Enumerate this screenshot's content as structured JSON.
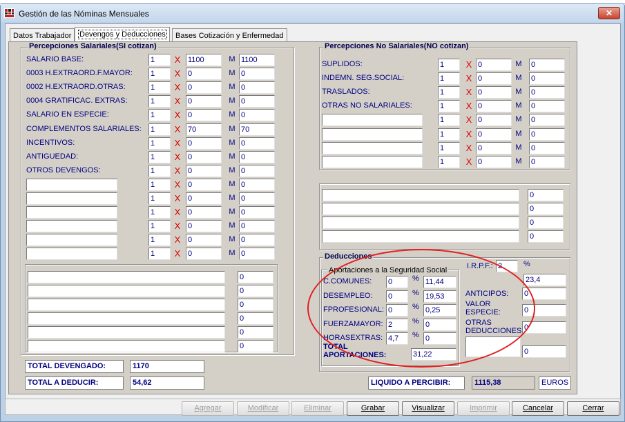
{
  "window": {
    "title": "Gestión de las Nóminas Mensuales",
    "close_label": "✕"
  },
  "tabs": [
    "Datos Trabajador",
    "Devengos y Deducciones",
    "Bases Cotización y Enfermedad"
  ],
  "salariales": {
    "title": "Percepciones Salariales(SI cotizan)",
    "rows": [
      {
        "label": "SALARIO BASE:",
        "qty": "1",
        "price": "1100",
        "total": "1100"
      },
      {
        "label": "0003 H.EXTRAORD.F.MAYOR:",
        "qty": "1",
        "price": "0",
        "total": "0"
      },
      {
        "label": "0002 H.EXTRAORD.OTRAS:",
        "qty": "1",
        "price": "0",
        "total": "0"
      },
      {
        "label": "0004 GRATIFICAC. EXTRAS:",
        "qty": "1",
        "price": "0",
        "total": "0"
      },
      {
        "label": "SALARIO EN ESPECIE:",
        "qty": "1",
        "price": "0",
        "total": "0"
      },
      {
        "label": "COMPLEMENTOS SALARIALES:",
        "qty": "1",
        "price": "70",
        "total": "70"
      },
      {
        "label": "INCENTIVOS:",
        "qty": "1",
        "price": "0",
        "total": "0"
      },
      {
        "label": "ANTIGUEDAD:",
        "qty": "1",
        "price": "0",
        "total": "0"
      },
      {
        "label": "OTROS DEVENGOS:",
        "qty": "1",
        "price": "0",
        "total": "0"
      },
      {
        "label": "",
        "qty": "1",
        "price": "0",
        "total": "0"
      },
      {
        "label": "",
        "qty": "1",
        "price": "0",
        "total": "0"
      },
      {
        "label": "",
        "qty": "1",
        "price": "0",
        "total": "0"
      },
      {
        "label": "",
        "qty": "1",
        "price": "0",
        "total": "0"
      },
      {
        "label": "",
        "qty": "1",
        "price": "0",
        "total": "0"
      },
      {
        "label": "",
        "qty": "1",
        "price": "0",
        "total": "0"
      }
    ],
    "extra_rows": [
      "0",
      "0",
      "0",
      "0",
      "0",
      "0"
    ]
  },
  "no_salariales": {
    "title": "Percepciones No Salariales(NO cotizan)",
    "rows": [
      {
        "label": "SUPLIDOS:",
        "qty": "1",
        "price": "0",
        "total": "0"
      },
      {
        "label": "INDEMN. SEG.SOCIAL:",
        "qty": "1",
        "price": "0",
        "total": "0"
      },
      {
        "label": "TRASLADOS:",
        "qty": "1",
        "price": "0",
        "total": "0"
      },
      {
        "label": "OTRAS NO SALARIALES:",
        "qty": "1",
        "price": "0",
        "total": "0"
      },
      {
        "label": "",
        "qty": "1",
        "price": "0",
        "total": "0"
      },
      {
        "label": "",
        "qty": "1",
        "price": "0",
        "total": "0"
      },
      {
        "label": "",
        "qty": "1",
        "price": "0",
        "total": "0"
      },
      {
        "label": "",
        "qty": "1",
        "price": "0",
        "total": "0"
      }
    ],
    "extra_rows": [
      "0",
      "0",
      "0",
      "0"
    ]
  },
  "deducciones": {
    "title": "Deducciones",
    "ss_title": "Aportaciones a la Seguridad Social",
    "ss_rows": [
      {
        "label": "C.COMUNES:",
        "pct": "0",
        "value": "11,44"
      },
      {
        "label": "DESEMPLEO:",
        "pct": "0",
        "value": "19,53"
      },
      {
        "label": "FPROFESIONAL:",
        "pct": "0",
        "value": "0,25"
      },
      {
        "label": "FUERZAMAYOR:",
        "pct": "2",
        "value": "0"
      },
      {
        "label": "HORASEXTRAS:",
        "pct": "4,7",
        "value": "0"
      }
    ],
    "total_aportaciones_label": "TOTAL APORTACIONES:",
    "total_aportaciones": "31,22",
    "irpf_label": "I.R.P.F.:",
    "irpf_pct": "2",
    "irpf_value": "23,4",
    "anticipos_label": "ANTICIPOS:",
    "anticipos_value": "0",
    "valor_especie_label": "VALOR ESPECIE:",
    "valor_especie_value": "0",
    "otras_label": "OTRAS DEDUCCIONES:",
    "otras_value": "0",
    "extra_value": "0"
  },
  "totals": {
    "devengado_label": "TOTAL DEVENGADO:",
    "devengado": "1170",
    "deducir_label": "TOTAL A DEDUCIR:",
    "deducir": "54,62",
    "liquido_label": "LIQUIDO A PERCIBIR:",
    "liquido": "1115,38",
    "currency": "EUROS"
  },
  "symbols": {
    "x": "X",
    "m": "M",
    "pct": "%"
  },
  "buttons": [
    {
      "label": "Agregar",
      "enabled": false
    },
    {
      "label": "Modificar",
      "enabled": false
    },
    {
      "label": "Eliminar",
      "enabled": false
    },
    {
      "label": "Grabar",
      "enabled": true
    },
    {
      "label": "Visualizar",
      "enabled": true
    },
    {
      "label": "Imprimir",
      "enabled": false
    },
    {
      "label": "Cancelar",
      "enabled": true
    },
    {
      "label": "Cerrar",
      "enabled": true
    }
  ],
  "colors": {
    "label": "#000080",
    "highlight_oval": "#e02020"
  }
}
